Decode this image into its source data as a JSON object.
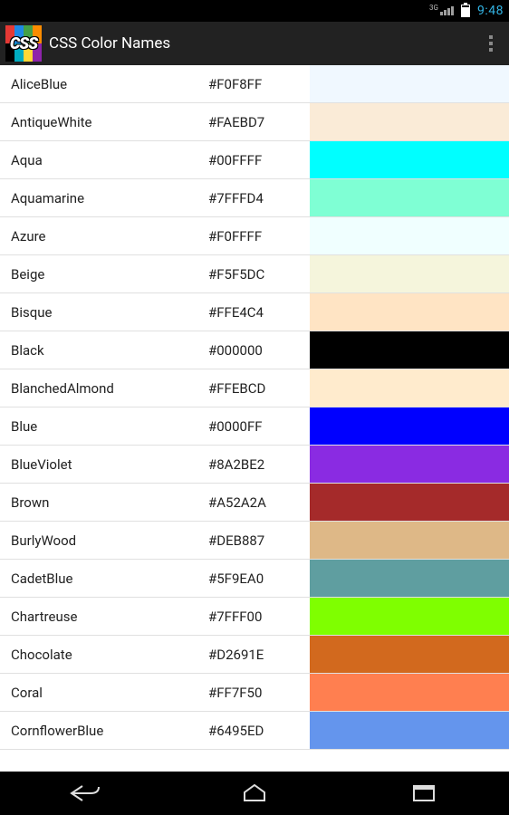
{
  "status": {
    "net_label": "3G",
    "time": "9:48"
  },
  "app": {
    "title": "CSS Color Names",
    "icon_text": "CSS"
  },
  "colors": [
    {
      "name": "AliceBlue",
      "hex": "#F0F8FF"
    },
    {
      "name": "AntiqueWhite",
      "hex": "#FAEBD7"
    },
    {
      "name": "Aqua",
      "hex": "#00FFFF"
    },
    {
      "name": "Aquamarine",
      "hex": "#7FFFD4"
    },
    {
      "name": "Azure",
      "hex": "#F0FFFF"
    },
    {
      "name": "Beige",
      "hex": "#F5F5DC"
    },
    {
      "name": "Bisque",
      "hex": "#FFE4C4"
    },
    {
      "name": "Black",
      "hex": "#000000"
    },
    {
      "name": "BlanchedAlmond",
      "hex": "#FFEBCD"
    },
    {
      "name": "Blue",
      "hex": "#0000FF"
    },
    {
      "name": "BlueViolet",
      "hex": "#8A2BE2"
    },
    {
      "name": "Brown",
      "hex": "#A52A2A"
    },
    {
      "name": "BurlyWood",
      "hex": "#DEB887"
    },
    {
      "name": "CadetBlue",
      "hex": "#5F9EA0"
    },
    {
      "name": "Chartreuse",
      "hex": "#7FFF00"
    },
    {
      "name": "Chocolate",
      "hex": "#D2691E"
    },
    {
      "name": "Coral",
      "hex": "#FF7F50"
    },
    {
      "name": "CornflowerBlue",
      "hex": "#6495ED"
    }
  ]
}
